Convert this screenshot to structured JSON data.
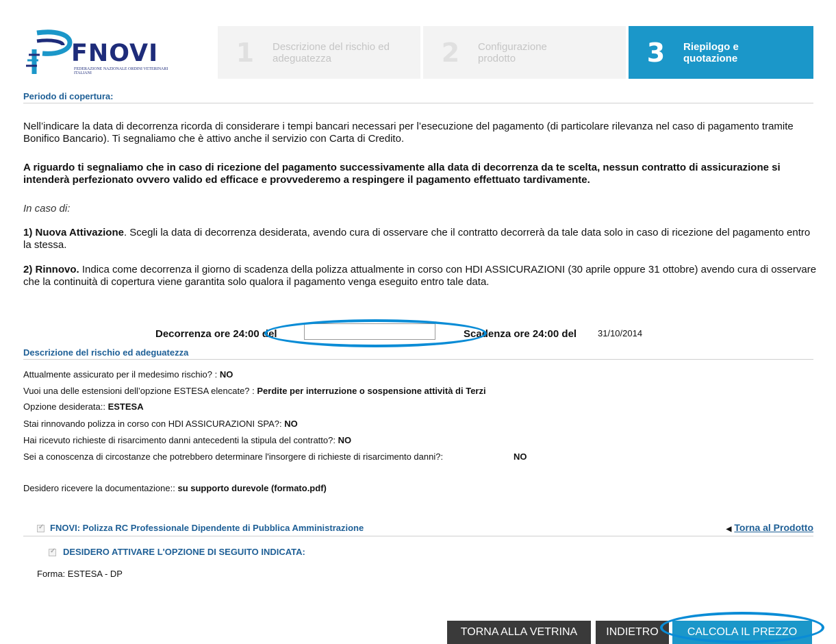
{
  "header": {
    "logo": {
      "name": "FNOVI",
      "subtitle": "FEDERAZIONE NAZIONALE ORDINI VETERINARI ITALIANI"
    },
    "steps": [
      {
        "num": "1",
        "label": "Descrizione del rischio ed adeguatezza"
      },
      {
        "num": "2",
        "label": "Configurazione prodotto"
      },
      {
        "num": "3",
        "label": "Riepilogo e quotazione"
      }
    ]
  },
  "periodo": {
    "title": "Periodo di copertura:",
    "intro": "Nell’indicare la data di decorrenza ricorda di considerare i tempi bancari necessari per l’esecuzione del pagamento (di particolare rilevanza nel caso di pagamento tramite Bonifico Bancario). Ti segnaliamo che è attivo anche il servizio con Carta di Credito.",
    "warning": "A riguardo ti segnaliamo che in caso di ricezione del pagamento successivamente alla data di decorrenza da te scelta, nessun contratto di assicurazione si intenderà perfezionato ovvero valido ed efficace e provvederemo a respingere il pagamento effettuato tardivamente.",
    "in_caso": "In caso di:",
    "item1_title": "1) Nuova Attivazione",
    "item1_text": ". Scegli la data di decorrenza desiderata, avendo cura di osservare che il contratto decorrerà da tale data solo in caso di ricezione del pagamento entro la stessa.",
    "item2_title": "2) Rinnovo.",
    "item2_text": " Indica come decorrenza il giorno di scadenza della polizza attualmente in corso con HDI ASSICURAZIONI (30 aprile oppure 31 ottobre) avendo cura di osservare che la continuità di copertura viene garantita solo qualora il pagamento venga eseguito entro tale data."
  },
  "dates": {
    "decorrenza_label": "Decorrenza ore 24:00 del",
    "decorrenza_value": "",
    "scadenza_label": "Scadenza ore 24:00 del",
    "scadenza_value": "31/10/2014"
  },
  "rischio": {
    "title": "Descrizione del rischio ed adeguatezza",
    "rows": [
      {
        "q": "Attualmente assicurato per il medesimo rischio? :",
        "a": "NO"
      },
      {
        "q": "Vuoi una delle estensioni dell’opzione ESTESA elencate? :",
        "a": "Perdite per interruzione o sospensione attività di Terzi"
      },
      {
        "q": "Opzione desiderata::",
        "a": "ESTESA"
      },
      {
        "q": "Stai rinnovando polizza in corso con HDI ASSICURAZIONI SPA?:",
        "a": "NO"
      },
      {
        "q": "Hai ricevuto richieste di risarcimento danni antecedenti la stipula del contratto?:",
        "a": "NO"
      },
      {
        "q": "Sei a conoscenza di circostanze che potrebbero determinare l'insorgere di richieste di risarcimento danni?:",
        "a": "NO"
      },
      {
        "q": "Desidero ricevere la documentazione::",
        "a": "su supporto durevole (formato.pdf)"
      }
    ]
  },
  "product": {
    "name": "FNOVI: Polizza RC Professionale Dipendente di Pubblica Amministrazione",
    "back_link": "Torna al Prodotto",
    "option": "DESIDERO ATTIVARE L'OPZIONE DI SEGUITO INDICATA:",
    "forma": "Forma: ESTESA - DP"
  },
  "buttons": {
    "vetrina": "TORNA ALLA VETRINA",
    "indietro": "INDIETRO",
    "calcola": "CALCOLA IL PREZZO"
  },
  "colors": {
    "accent": "#1b97c9",
    "title": "#1e5f96",
    "annotation": "#0a8cd6",
    "button_dark": "#3a3a3a"
  }
}
